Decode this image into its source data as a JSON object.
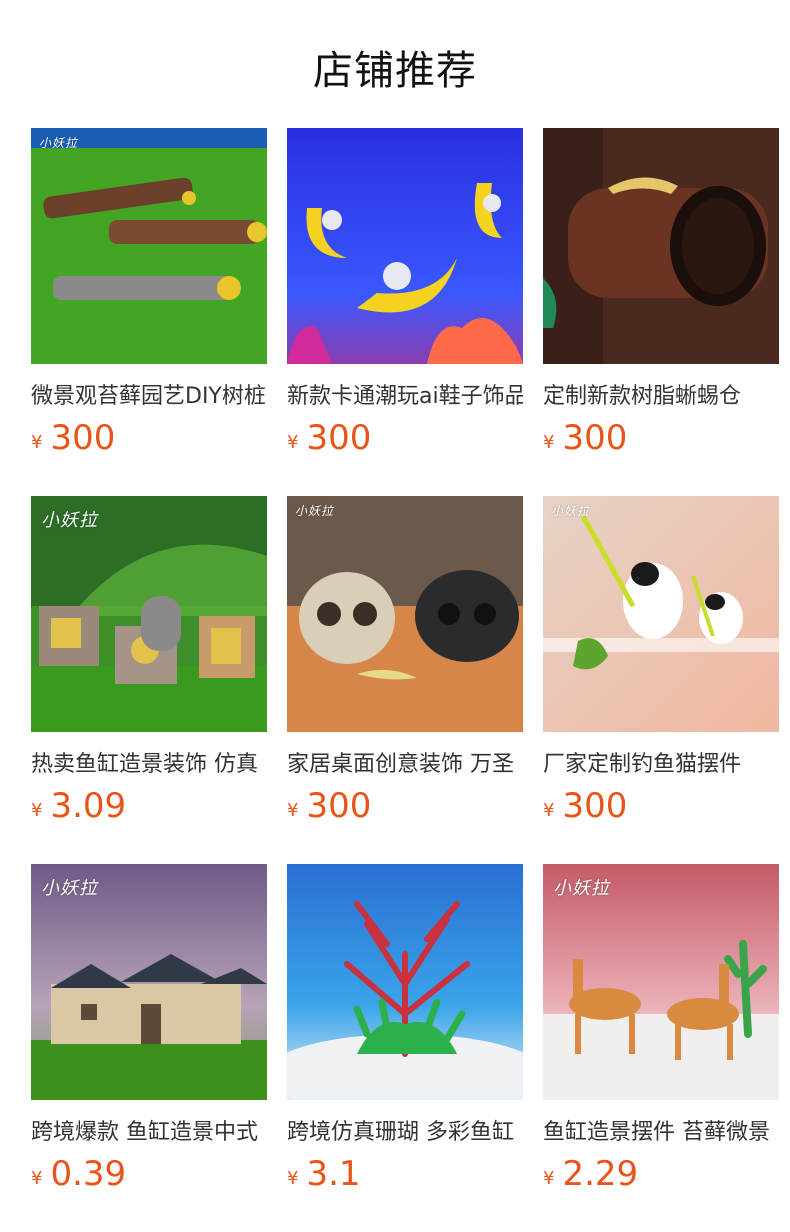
{
  "header": {
    "title": "店铺推荐"
  },
  "products": [
    {
      "name": "微景观苔藓园艺DIY树桩",
      "currency": "¥",
      "price": "300",
      "brand": "小妖拉"
    },
    {
      "name": "新款卡通潮玩ai鞋子饰品",
      "currency": "¥",
      "price": "300",
      "brand": ""
    },
    {
      "name": "定制新款树脂蜥蜴仓",
      "currency": "¥",
      "price": "300",
      "brand": ""
    },
    {
      "name": "热卖鱼缸造景装饰 仿真",
      "currency": "¥",
      "price": "3.09",
      "brand": "小妖拉"
    },
    {
      "name": "家居桌面创意装饰 万圣",
      "currency": "¥",
      "price": "300",
      "brand": "小妖拉"
    },
    {
      "name": "厂家定制钓鱼猫摆件",
      "currency": "¥",
      "price": "300",
      "brand": "小妖拉"
    },
    {
      "name": "跨境爆款 鱼缸造景中式",
      "currency": "¥",
      "price": "0.39",
      "brand": "小妖拉"
    },
    {
      "name": "跨境仿真珊瑚 多彩鱼缸",
      "currency": "¥",
      "price": "3.1",
      "brand": ""
    },
    {
      "name": "鱼缸造景摆件 苔藓微景",
      "currency": "¥",
      "price": "2.29",
      "brand": "小妖拉"
    }
  ]
}
